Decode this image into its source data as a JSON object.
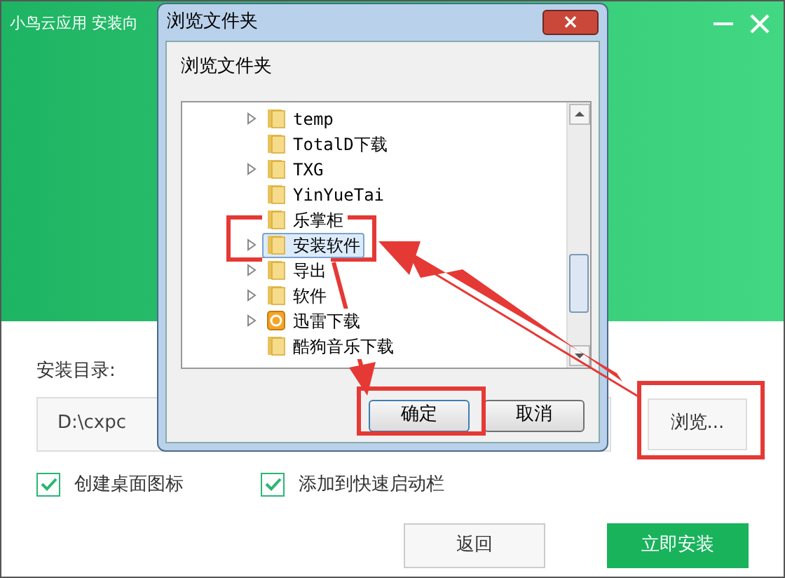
{
  "window": {
    "title": "小鸟云应用 安装向"
  },
  "dialog": {
    "title": "浏览文件夹",
    "prompt": "浏览文件夹",
    "close": "×",
    "tree": [
      {
        "label": "temp",
        "kind": "folder",
        "expandable": true,
        "selected": false
      },
      {
        "label": "TotalD下载",
        "kind": "folder",
        "expandable": false,
        "selected": false
      },
      {
        "label": "TXG",
        "kind": "folder",
        "expandable": true,
        "selected": false
      },
      {
        "label": "YinYueTai",
        "kind": "folder",
        "expandable": false,
        "selected": false
      },
      {
        "label": "乐掌柜",
        "kind": "folder",
        "expandable": false,
        "selected": false
      },
      {
        "label": "安装软件",
        "kind": "folder",
        "expandable": true,
        "selected": true
      },
      {
        "label": "导出",
        "kind": "folder",
        "expandable": true,
        "selected": false
      },
      {
        "label": "软件",
        "kind": "folder",
        "expandable": true,
        "selected": false
      },
      {
        "label": "迅雷下载",
        "kind": "app",
        "expandable": true,
        "selected": false
      },
      {
        "label": "酷狗音乐下载",
        "kind": "folder",
        "expandable": false,
        "selected": false
      }
    ],
    "buttons": [
      {
        "label": "确定",
        "default": true
      },
      {
        "label": "取消",
        "default": false
      }
    ]
  },
  "install_dir": {
    "label": "安装目录:",
    "value": "D:\\cxpc",
    "browse": "浏览..."
  },
  "options": [
    {
      "label": "创建桌面图标",
      "checked": true
    },
    {
      "label": "添加到快速启动栏",
      "checked": true
    }
  ],
  "actions": [
    {
      "label": "返回",
      "kind": "secondary"
    },
    {
      "label": "立即安装",
      "kind": "primary"
    }
  ]
}
